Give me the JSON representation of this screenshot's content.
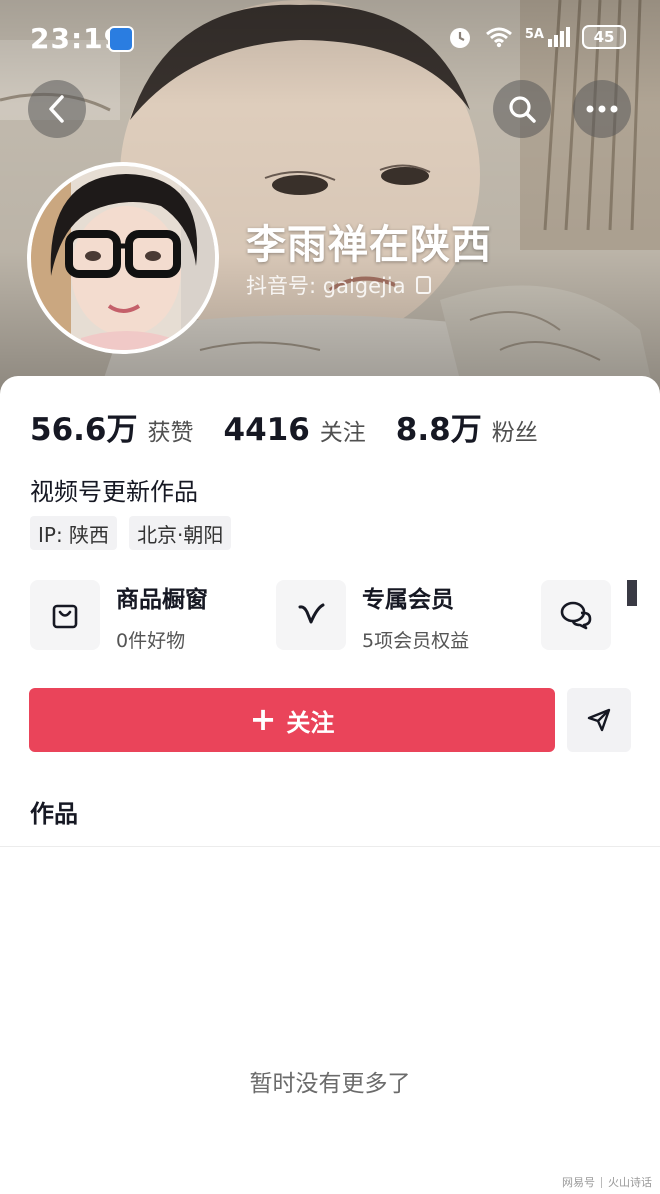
{
  "status_bar": {
    "time": "23:19",
    "network": "5A",
    "battery": "45"
  },
  "header": {
    "back_icon": "chevron-left-icon",
    "search_icon": "search-icon",
    "more_icon": "more-dots-icon"
  },
  "profile": {
    "nickname": "李雨禅在陕西",
    "douyin_id": "抖音号: gaigejia"
  },
  "stats": [
    {
      "value": "56.6万",
      "label": "获赞"
    },
    {
      "value": "4416",
      "label": "关注"
    },
    {
      "value": "8.8万",
      "label": "粉丝"
    }
  ],
  "bio": "视频号更新作品",
  "tags": [
    "IP: 陕西",
    "北京·朝阳"
  ],
  "features": [
    {
      "title": "商品橱窗",
      "subtitle": "0件好物",
      "icon": "shopping-bag-icon"
    },
    {
      "title": "专属会员",
      "subtitle": "5项会员权益",
      "icon": "vip-v-icon"
    },
    {
      "title": "",
      "subtitle": "",
      "icon": "chat-bubbles-icon"
    }
  ],
  "actions": {
    "follow_label": "关注",
    "share_icon": "send-icon"
  },
  "tabs": {
    "works_label": "作品"
  },
  "empty_state": "暂时没有更多了",
  "watermark": {
    "left": "网易号",
    "right": "火山诗话"
  },
  "colors": {
    "follow_button": "#ea445a",
    "text_primary": "#161823",
    "tag_background": "#f2f2f4"
  }
}
